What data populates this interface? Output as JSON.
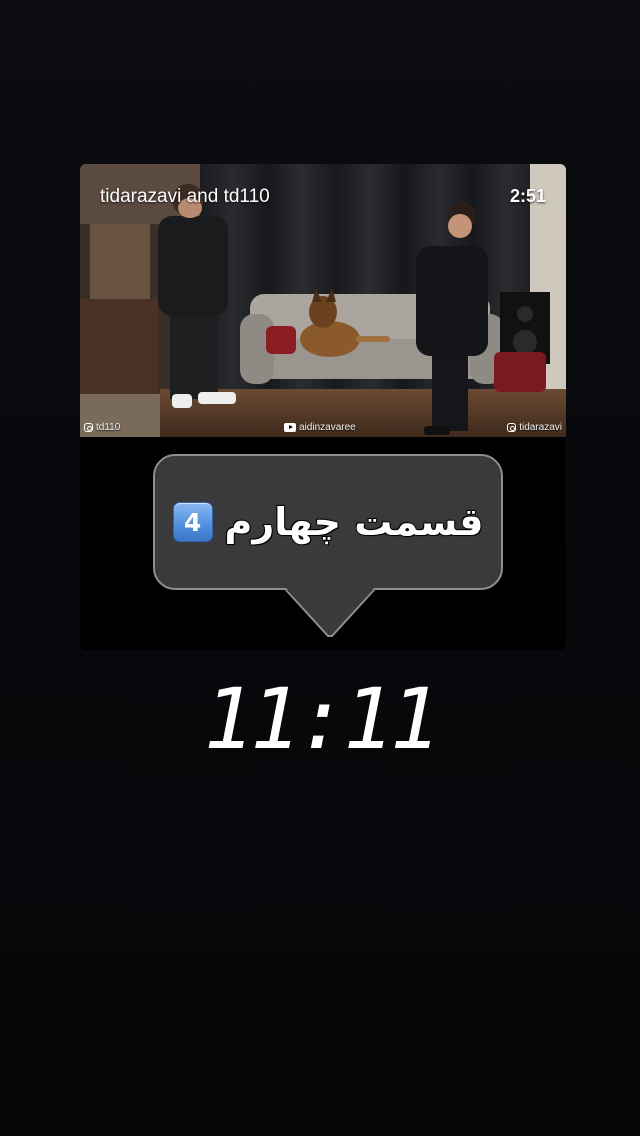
{
  "video": {
    "overlay_title": "tidarazavi and td110",
    "duration": "2:51",
    "watermarks": {
      "left": "td110",
      "center": "aidinzavaree",
      "right": "tidarazavi"
    }
  },
  "sticker": {
    "text": "قسمت چهارم",
    "keycap_number": "4",
    "keycap_emoji_name": "keycap-4-emoji"
  },
  "time_text": "11:11",
  "colors": {
    "background": "#07080b",
    "bubble_fill": "#3a3a3c",
    "bubble_border": "#8e8e93",
    "keycap": "#4f8fdc"
  }
}
